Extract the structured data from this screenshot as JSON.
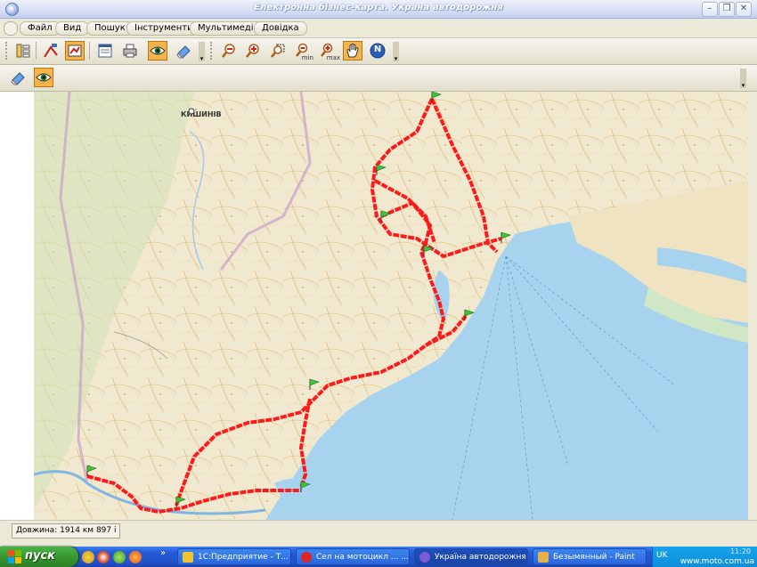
{
  "window": {
    "title": "Електронна бізнес-карта. Украна автодорожня"
  },
  "window_buttons": {
    "minimize": "–",
    "restore": "❐",
    "close": "✕"
  },
  "menu": [
    "Файл",
    "Вид",
    "Пошук",
    "Інструменти",
    "Мультимедіа",
    "Довідка"
  ],
  "toolbar": {
    "zoom_min_label": "min",
    "zoom_max_label": "max",
    "navigator_label": "N"
  },
  "map": {
    "label_chisinau": "КИШИНІВ"
  },
  "status": {
    "route_length": "Довжина: 1914 км 897 і"
  },
  "taskbar": {
    "start_label": "пуск",
    "tasks": [
      "1С:Предприятие - Т...",
      "Сел на мотоцикл ... ...",
      "Україна автодорожня",
      "Безымянный - Paint"
    ],
    "tray_lang": "UK",
    "clock": "11:20",
    "watermark": "www.moto.com.ua"
  },
  "colors": {
    "route": "#ff1a1a",
    "sea": "#a7d3ef",
    "land": "#f1e8d0",
    "active_tool": "#f5b44a",
    "taskbar": "#2459d8",
    "start": "#37962f"
  }
}
